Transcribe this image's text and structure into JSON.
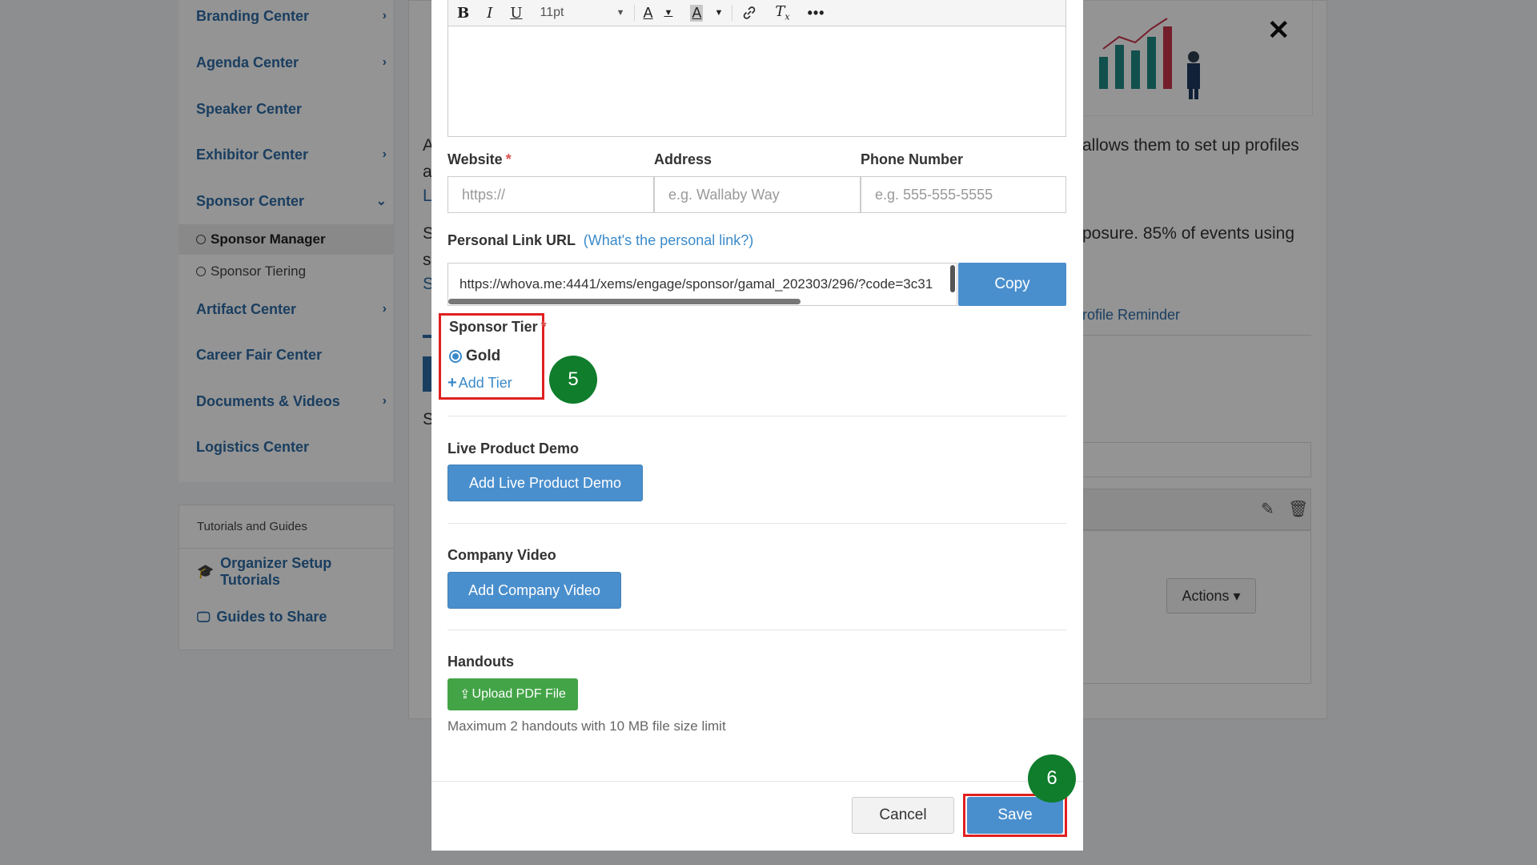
{
  "sidebar": {
    "items": [
      {
        "label": "Branding Center",
        "chevron": "›"
      },
      {
        "label": "Agenda Center",
        "chevron": "›"
      },
      {
        "label": "Speaker Center",
        "chevron": ""
      },
      {
        "label": "Exhibitor Center",
        "chevron": "›"
      },
      {
        "label": "Sponsor Center",
        "chevron": "⌄"
      }
    ],
    "sub_items": [
      {
        "label": "Sponsor Manager"
      },
      {
        "label": "Sponsor Tiering"
      }
    ],
    "items_after": [
      {
        "label": "Artifact Center",
        "chevron": "›"
      },
      {
        "label": "Career Fair Center",
        "chevron": ""
      },
      {
        "label": "Documents & Videos",
        "chevron": "›"
      },
      {
        "label": "Logistics Center",
        "chevron": ""
      }
    ],
    "tutorials_header": "Tutorials and Guides",
    "organizer_setup": "Organizer Setup Tutorials",
    "guides_to_share": "Guides to Share"
  },
  "background": {
    "text_line1": "allows them to set up profiles",
    "text_line2": "posure. 85% of events using",
    "profile_reminder": "rofile Reminder",
    "actions": "Actions ▾",
    "stray_a": "A",
    "stray_a2": "a",
    "stray_l": "L",
    "stray_s": "S",
    "stray_s2": "s",
    "stray_s3": "S",
    "stray_s4": "S"
  },
  "toolbar": {
    "bold": "B",
    "italic": "I",
    "underline": "U",
    "font_size": "11pt",
    "text_color": "A",
    "bg_color": "A",
    "more": "•••"
  },
  "form": {
    "website_label": "Website",
    "website_placeholder": "https://",
    "address_label": "Address",
    "address_placeholder": "e.g. Wallaby Way",
    "phone_label": "Phone Number",
    "phone_placeholder": "e.g. 555-555-5555",
    "personal_link_label": "Personal Link URL",
    "personal_link_help": "(What's the personal link?)",
    "personal_link_value": "https://whova.me:4441/xems/engage/sponsor/gamal_202303/296/?code=3c31",
    "copy_label": "Copy",
    "sponsor_tier_label": "Sponsor Tier",
    "tier_option": "Gold",
    "add_tier": "Add Tier",
    "live_demo_label": "Live Product Demo",
    "live_demo_button": "Add Live Product Demo",
    "company_video_label": "Company Video",
    "company_video_button": "Add Company Video",
    "handouts_label": "Handouts",
    "upload_button": "Upload PDF File",
    "handouts_hint": "Maximum 2 handouts with 10 MB file size limit",
    "required_mark": "*"
  },
  "footer": {
    "cancel": "Cancel",
    "save": "Save"
  },
  "annotations": {
    "step5": "5",
    "step6": "6"
  },
  "close_symbol": "✕",
  "colors": {
    "accent_blue": "#4a8fcd",
    "highlight_red": "#e02020",
    "badge_green": "#0f7d2c",
    "upload_green": "#43a447"
  }
}
